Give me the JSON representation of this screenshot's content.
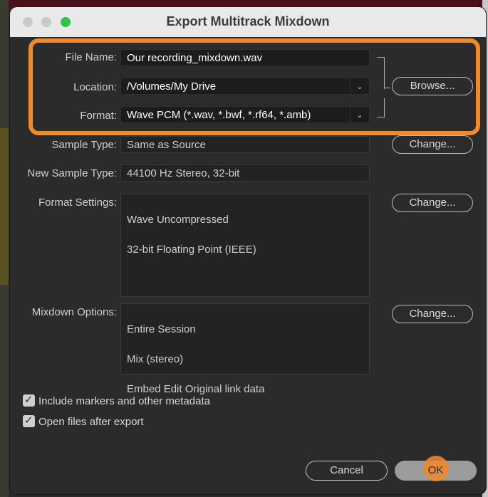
{
  "window": {
    "title": "Export Multitrack Mixdown"
  },
  "file_name": {
    "label": "File Name:",
    "value": "Our recording_mixdown.wav"
  },
  "location": {
    "label": "Location:",
    "value": "/Volumes/My Drive",
    "button": "Browse..."
  },
  "format": {
    "label": "Format:",
    "value": "Wave PCM (*.wav, *.bwf, *.rf64, *.amb)"
  },
  "sample_type": {
    "label": "Sample Type:",
    "value": "Same as Source",
    "button": "Change..."
  },
  "new_sample_type": {
    "label": "New Sample Type:",
    "value": "44100 Hz Stereo, 32-bit"
  },
  "format_settings": {
    "label": "Format Settings:",
    "lines": [
      "Wave Uncompressed",
      "32-bit Floating Point (IEEE)"
    ],
    "button": "Change..."
  },
  "mixdown_options": {
    "label": "Mixdown Options:",
    "lines": [
      "Entire Session",
      "Mix (stereo)",
      "Embed Edit Original link data"
    ],
    "button": "Change..."
  },
  "checkboxes": [
    {
      "label": "Include markers and other metadata",
      "checked": true
    },
    {
      "label": "Open files after export",
      "checked": true
    }
  ],
  "footer": {
    "cancel": "Cancel",
    "ok": "OK"
  },
  "colors": {
    "highlight": "#f08a2a",
    "zoom_button": "#2fc54a"
  }
}
